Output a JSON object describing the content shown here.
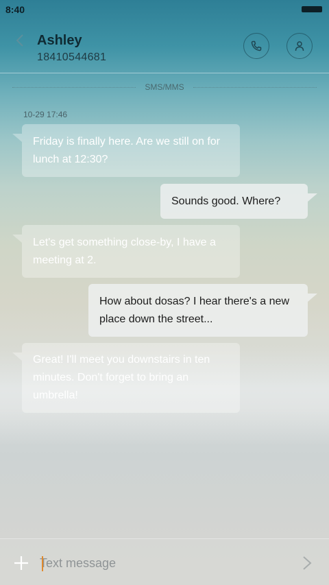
{
  "status_bar": {
    "time": "8:40"
  },
  "header": {
    "back_icon": "chevron-left-icon",
    "contact_name": "Ashley",
    "contact_number": "18410544681",
    "call_icon": "phone-icon",
    "profile_icon": "person-icon"
  },
  "thread": {
    "channel_label": "SMS/MMS",
    "timestamp": "10-29 17:46",
    "messages": [
      {
        "direction": "incoming",
        "text": "Friday is finally here. Are we still on for lunch at 12:30?"
      },
      {
        "direction": "outgoing",
        "text": "Sounds good. Where?"
      },
      {
        "direction": "incoming",
        "text": "Let's get something close-by, I have a meeting at 2."
      },
      {
        "direction": "outgoing",
        "text": "How about dosas? I hear there's a new place down the street..."
      },
      {
        "direction": "incoming",
        "text": "Great! I'll meet you downstairs in ten minutes. Don't forget to bring an umbrella!"
      }
    ]
  },
  "composer": {
    "placeholder": "Text message",
    "value": "",
    "attach_icon": "plus-icon",
    "send_icon": "chevron-right-icon"
  },
  "colors": {
    "accent_cursor": "#e08a2e",
    "incoming_text": "#ffffff",
    "outgoing_text": "#1c1c1c"
  }
}
